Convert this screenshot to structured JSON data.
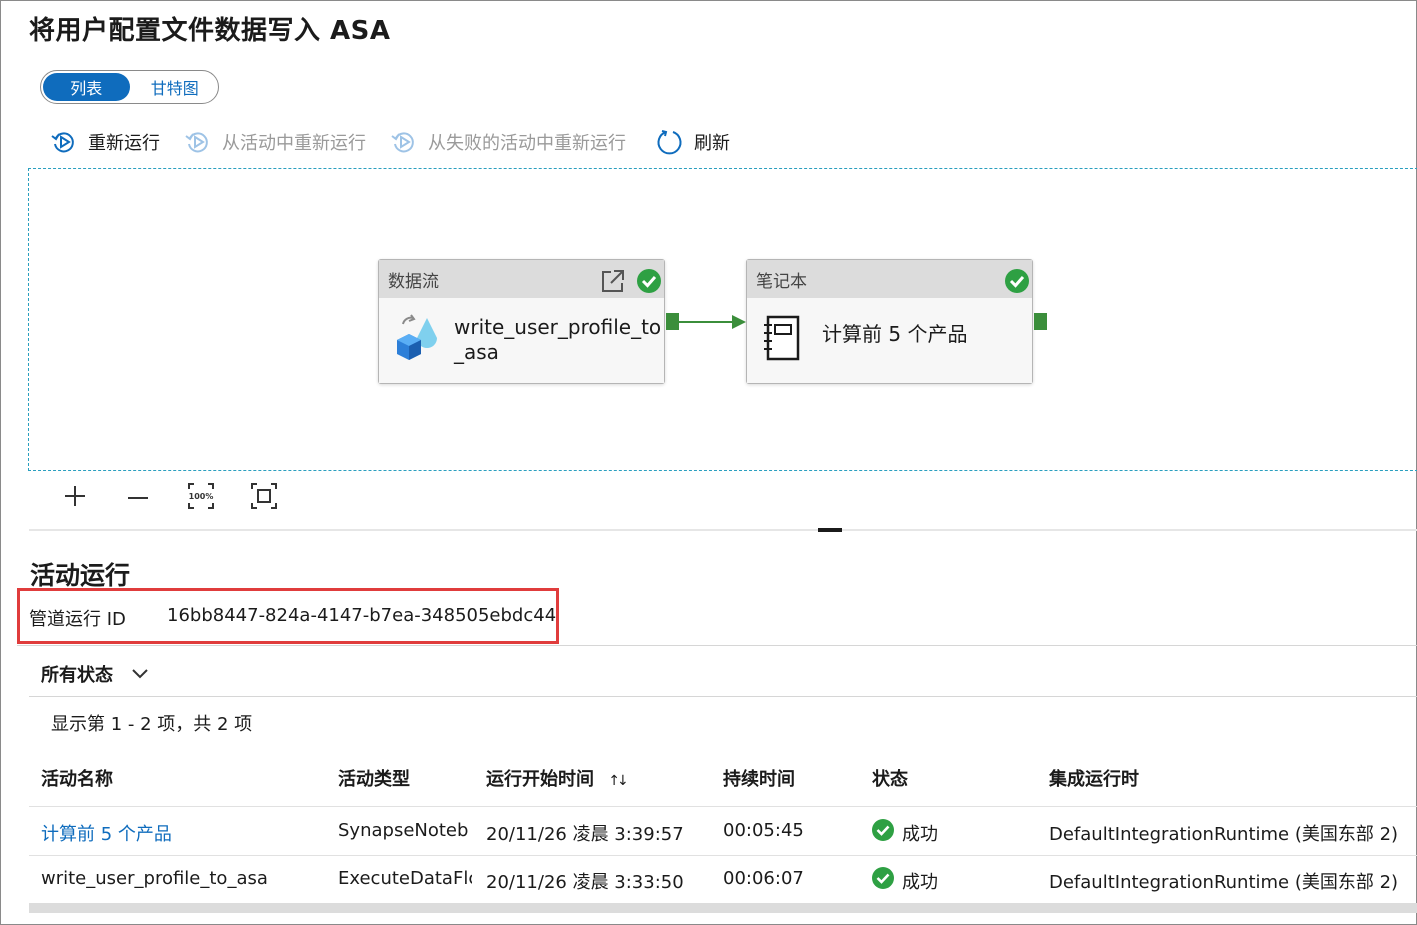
{
  "page": {
    "title": "将用户配置文件数据写入 ASA"
  },
  "view_toggle": {
    "list": "列表",
    "gantt": "甘特图"
  },
  "toolbar": {
    "rerun": "重新运行",
    "rerun_from_activity": "从活动中重新运行",
    "rerun_from_failed": "从失败的活动中重新运行",
    "refresh": "刷新"
  },
  "pipeline": {
    "node1": {
      "type": "数据流",
      "name_line1": "write_user_profile_to",
      "name_line2": "_asa"
    },
    "node2": {
      "type": "笔记本",
      "name": "计算前 5 个产品"
    }
  },
  "zoom": {
    "fit_label": "100%"
  },
  "activity_runs": {
    "title": "活动运行",
    "run_id_label": "管道运行 ID",
    "run_id": "16bb8447-824a-4147-b7ea-348505ebdc44",
    "filter": "所有状态",
    "count_text": "显示第 1 - 2 项，共 2 项",
    "columns": [
      "活动名称",
      "活动类型",
      "运行开始时间",
      "持续时间",
      "状态",
      "集成运行时"
    ],
    "sort_icon": "↑↓",
    "rows": [
      {
        "name": "计算前 5 个产品",
        "type": "SynapseNoteb",
        "start": "20/11/26 凌晨 3:39:57",
        "duration": "00:05:45",
        "status": "成功",
        "runtime": "DefaultIntegrationRuntime (美国东部 2)"
      },
      {
        "name": "write_user_profile_to_asa",
        "type": "ExecuteDataFlc",
        "start": "20/11/26 凌晨 3:33:50",
        "duration": "00:06:07",
        "status": "成功",
        "runtime": "DefaultIntegrationRuntime (美国东部 2)"
      }
    ]
  },
  "colors": {
    "accent": "#0f6cbd",
    "success": "#2ea043",
    "highlight": "#e03c3c",
    "port": "#3b8e3b"
  }
}
